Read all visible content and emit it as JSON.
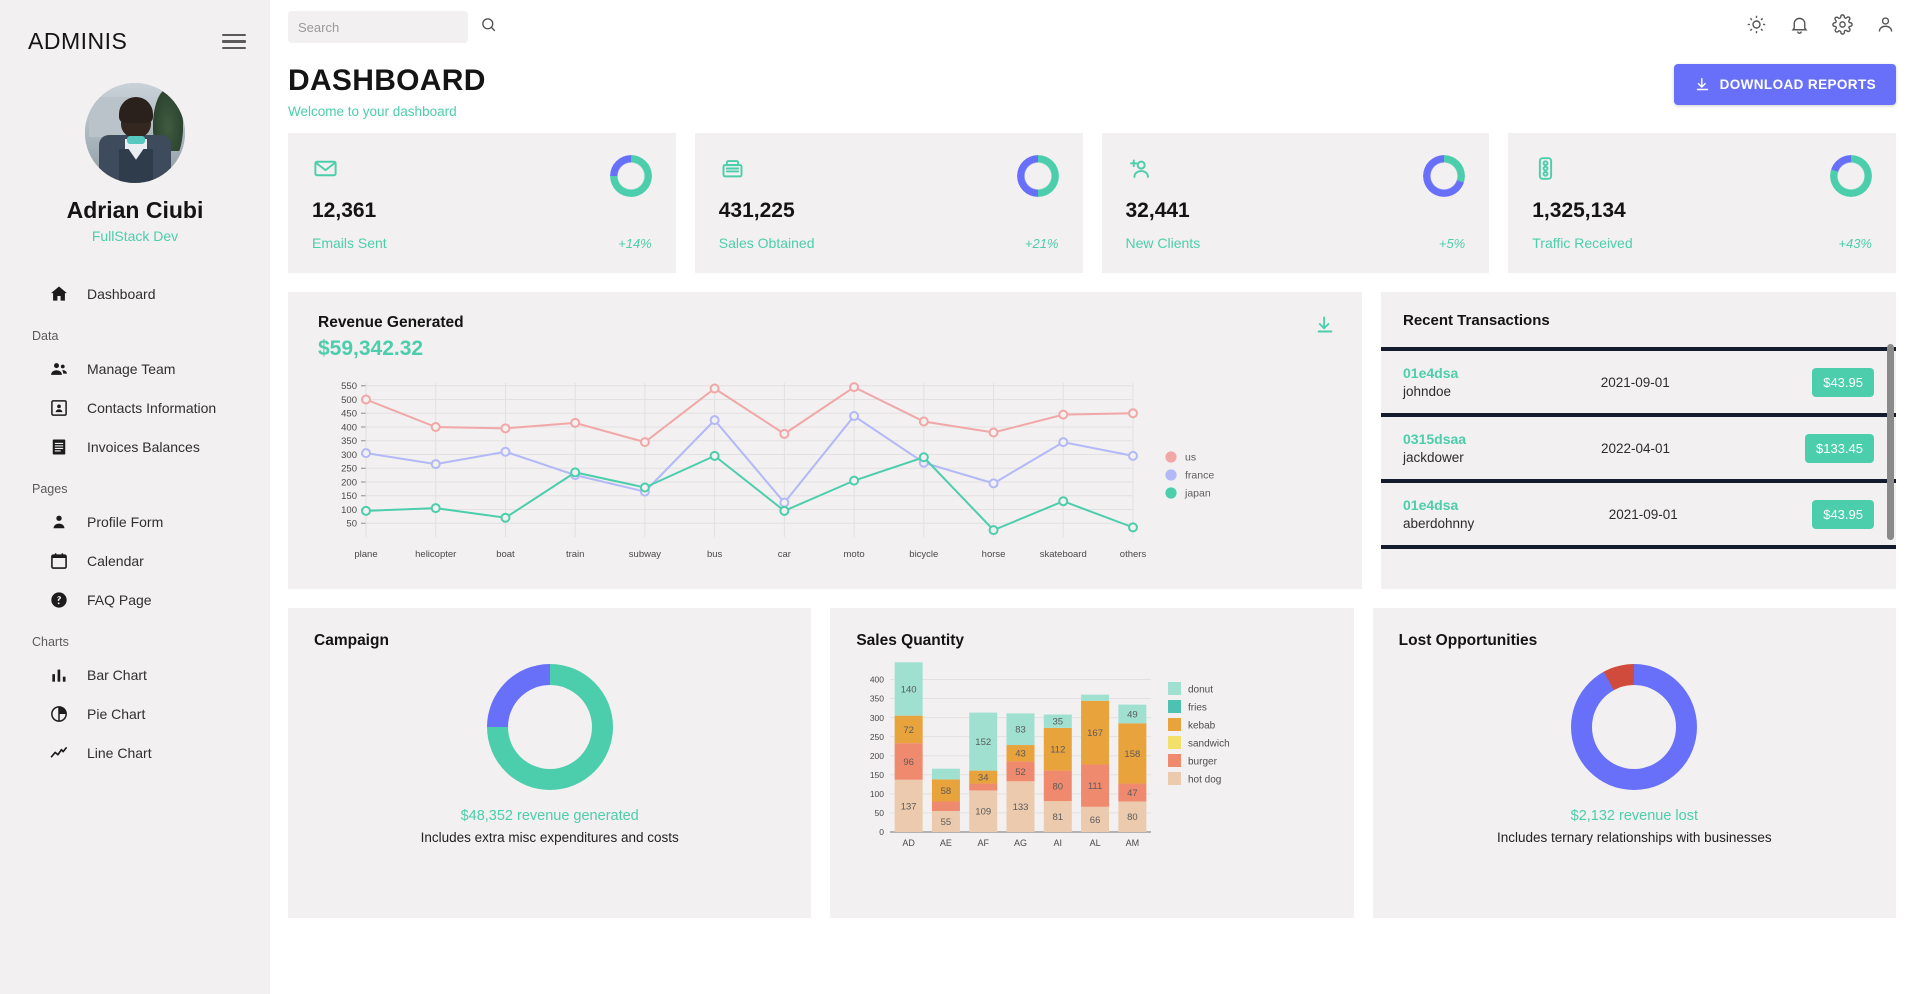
{
  "sidebar": {
    "logo": "ADMINIS",
    "profile": {
      "name": "Adrian Ciubi",
      "role": "FullStack Dev"
    },
    "items": [
      {
        "label": "Dashboard",
        "icon": "home-icon",
        "type": "item"
      },
      {
        "label": "Data",
        "type": "section"
      },
      {
        "label": "Manage Team",
        "icon": "people-icon",
        "type": "item"
      },
      {
        "label": "Contacts Information",
        "icon": "contacts-icon",
        "type": "item"
      },
      {
        "label": "Invoices Balances",
        "icon": "receipt-icon",
        "type": "item"
      },
      {
        "label": "Pages",
        "type": "section"
      },
      {
        "label": "Profile Form",
        "icon": "person-icon",
        "type": "item"
      },
      {
        "label": "Calendar",
        "icon": "calendar-icon",
        "type": "item"
      },
      {
        "label": "FAQ Page",
        "icon": "help-icon",
        "type": "item"
      },
      {
        "label": "Charts",
        "type": "section"
      },
      {
        "label": "Bar Chart",
        "icon": "bar-chart-icon",
        "type": "item"
      },
      {
        "label": "Pie Chart",
        "icon": "pie-chart-icon",
        "type": "item"
      },
      {
        "label": "Line Chart",
        "icon": "line-chart-icon",
        "type": "item"
      }
    ]
  },
  "topbar": {
    "search_placeholder": "Search",
    "search_value": "",
    "icons": [
      "light-mode-icon",
      "notifications-icon",
      "settings-icon",
      "person-icon"
    ]
  },
  "header": {
    "title": "DASHBOARD",
    "subtitle": "Welcome to your dashboard",
    "download_button": "DOWNLOAD REPORTS"
  },
  "stats": [
    {
      "value": "12,361",
      "label": "Emails Sent",
      "percent": "+14%",
      "icon": "email-icon",
      "progress": 0.75
    },
    {
      "value": "431,225",
      "label": "Sales Obtained",
      "percent": "+21%",
      "icon": "register-icon",
      "progress": 0.5
    },
    {
      "value": "32,441",
      "label": "New Clients",
      "percent": "+5%",
      "icon": "add-person-icon",
      "progress": 0.3
    },
    {
      "value": "1,325,134",
      "label": "Traffic Received",
      "percent": "+43%",
      "icon": "traffic-icon",
      "progress": 0.8
    }
  ],
  "revenue": {
    "title": "Revenue Generated",
    "amount": "$59,342.32",
    "download_icon": "download-icon"
  },
  "transactions": {
    "title": "Recent Transactions",
    "rows": [
      {
        "txId": "01e4dsa",
        "user": "johndoe",
        "date": "2021-09-01",
        "cost": "$43.95"
      },
      {
        "txId": "0315dsaa",
        "user": "jackdower",
        "date": "2022-04-01",
        "cost": "$133.45"
      },
      {
        "txId": "01e4dsa",
        "user": "aberdohnny",
        "date": "2021-09-01",
        "cost": "$43.95"
      }
    ]
  },
  "campaign": {
    "title": "Campaign",
    "caption": "$48,352 revenue generated",
    "subcaption": "Includes extra misc expenditures and costs"
  },
  "sales_quantity": {
    "title": "Sales Quantity"
  },
  "lost_opportunities": {
    "title": "Lost Opportunities",
    "caption": "$2,132 revenue lost",
    "subcaption": "Includes ternary relationships with businesses"
  },
  "colors": {
    "accent_green": "#4cceac",
    "accent_blue": "#6870fa",
    "panel_bg": "#f2f0f0",
    "dark": "#141b2d",
    "us": "#f1a7a7",
    "france": "#b3b8f7",
    "japan": "#4cceac",
    "red": "#d14b3c"
  },
  "chart_data": [
    {
      "type": "line",
      "title": "Revenue Generated",
      "xlabel": "",
      "ylabel": "",
      "ylim": [
        0,
        560
      ],
      "yticks": [
        50,
        100,
        150,
        200,
        250,
        300,
        350,
        400,
        450,
        500,
        550
      ],
      "grid": true,
      "legend_position": "right",
      "categories": [
        "plane",
        "helicopter",
        "boat",
        "train",
        "subway",
        "bus",
        "car",
        "moto",
        "bicycle",
        "horse",
        "skateboard",
        "others"
      ],
      "series": [
        {
          "name": "us",
          "color": "#f1a7a7",
          "values": [
            500,
            400,
            395,
            415,
            345,
            540,
            375,
            545,
            420,
            380,
            445,
            450
          ]
        },
        {
          "name": "france",
          "color": "#b3b8f7",
          "values": [
            305,
            265,
            310,
            225,
            165,
            425,
            125,
            440,
            270,
            195,
            345,
            295
          ]
        },
        {
          "name": "japan",
          "color": "#4cceac",
          "values": [
            95,
            105,
            70,
            235,
            180,
            295,
            95,
            205,
            290,
            25,
            130,
            35
          ]
        }
      ]
    },
    {
      "type": "bar",
      "subtype": "stacked",
      "title": "Sales Quantity",
      "xlabel": "",
      "ylabel": "",
      "ylim": [
        0,
        430
      ],
      "yticks": [
        0,
        50,
        100,
        150,
        200,
        250,
        300,
        350,
        400
      ],
      "grid": true,
      "legend_position": "right",
      "categories": [
        "AD",
        "AE",
        "AF",
        "AG",
        "AI",
        "AL",
        "AM"
      ],
      "series": [
        {
          "name": "hot dog",
          "color": "#eccaae",
          "values": [
            137,
            55,
            109,
            133,
            81,
            66,
            80
          ]
        },
        {
          "name": "burger",
          "color": "#f08a6e",
          "values": [
            96,
            25,
            18,
            52,
            80,
            111,
            47
          ]
        },
        {
          "name": "sandwich",
          "color": "#f2e06b",
          "values": [
            0,
            0,
            0,
            0,
            0,
            0,
            0
          ]
        },
        {
          "name": "kebab",
          "color": "#e8a33d",
          "values": [
            72,
            58,
            34,
            43,
            112,
            167,
            158
          ]
        },
        {
          "name": "fries",
          "color": "#4ec2b0",
          "values": [
            0,
            0,
            0,
            0,
            0,
            0,
            0
          ]
        },
        {
          "name": "donut",
          "color": "#9fe0d0",
          "values": [
            140,
            28,
            152,
            83,
            35,
            16,
            49
          ]
        }
      ],
      "bar_labels": {
        "AD": {
          "hot dog": "137",
          "burger": "96",
          "kebab": "72",
          "donut": "140"
        },
        "AE": {
          "hot dog": "55",
          "kebab": "58"
        },
        "AF": {
          "hot dog": "109",
          "kebab": "34",
          "donut": "152"
        },
        "AG": {
          "hot dog": "133",
          "burger": "52",
          "kebab": "43",
          "donut": "83"
        },
        "AI": {
          "hot dog": "81",
          "burger": "80",
          "kebab": "112",
          "donut": "35"
        },
        "AL": {
          "hot dog": "66",
          "burger": "111",
          "kebab": "167"
        },
        "AM": {
          "hot dog": "80",
          "burger": "47",
          "kebab": "158",
          "donut": "49"
        }
      }
    },
    {
      "type": "pie",
      "subtype": "donut",
      "title": "Campaign",
      "labels": [
        "generated",
        "remaining"
      ],
      "values": [
        75,
        25
      ],
      "colors": [
        "#4cceac",
        "#6870fa"
      ]
    },
    {
      "type": "pie",
      "subtype": "donut",
      "title": "Lost Opportunities",
      "labels": [
        "remaining",
        "lost"
      ],
      "values": [
        92,
        8
      ],
      "colors": [
        "#6870fa",
        "#d14b3c"
      ]
    }
  ]
}
